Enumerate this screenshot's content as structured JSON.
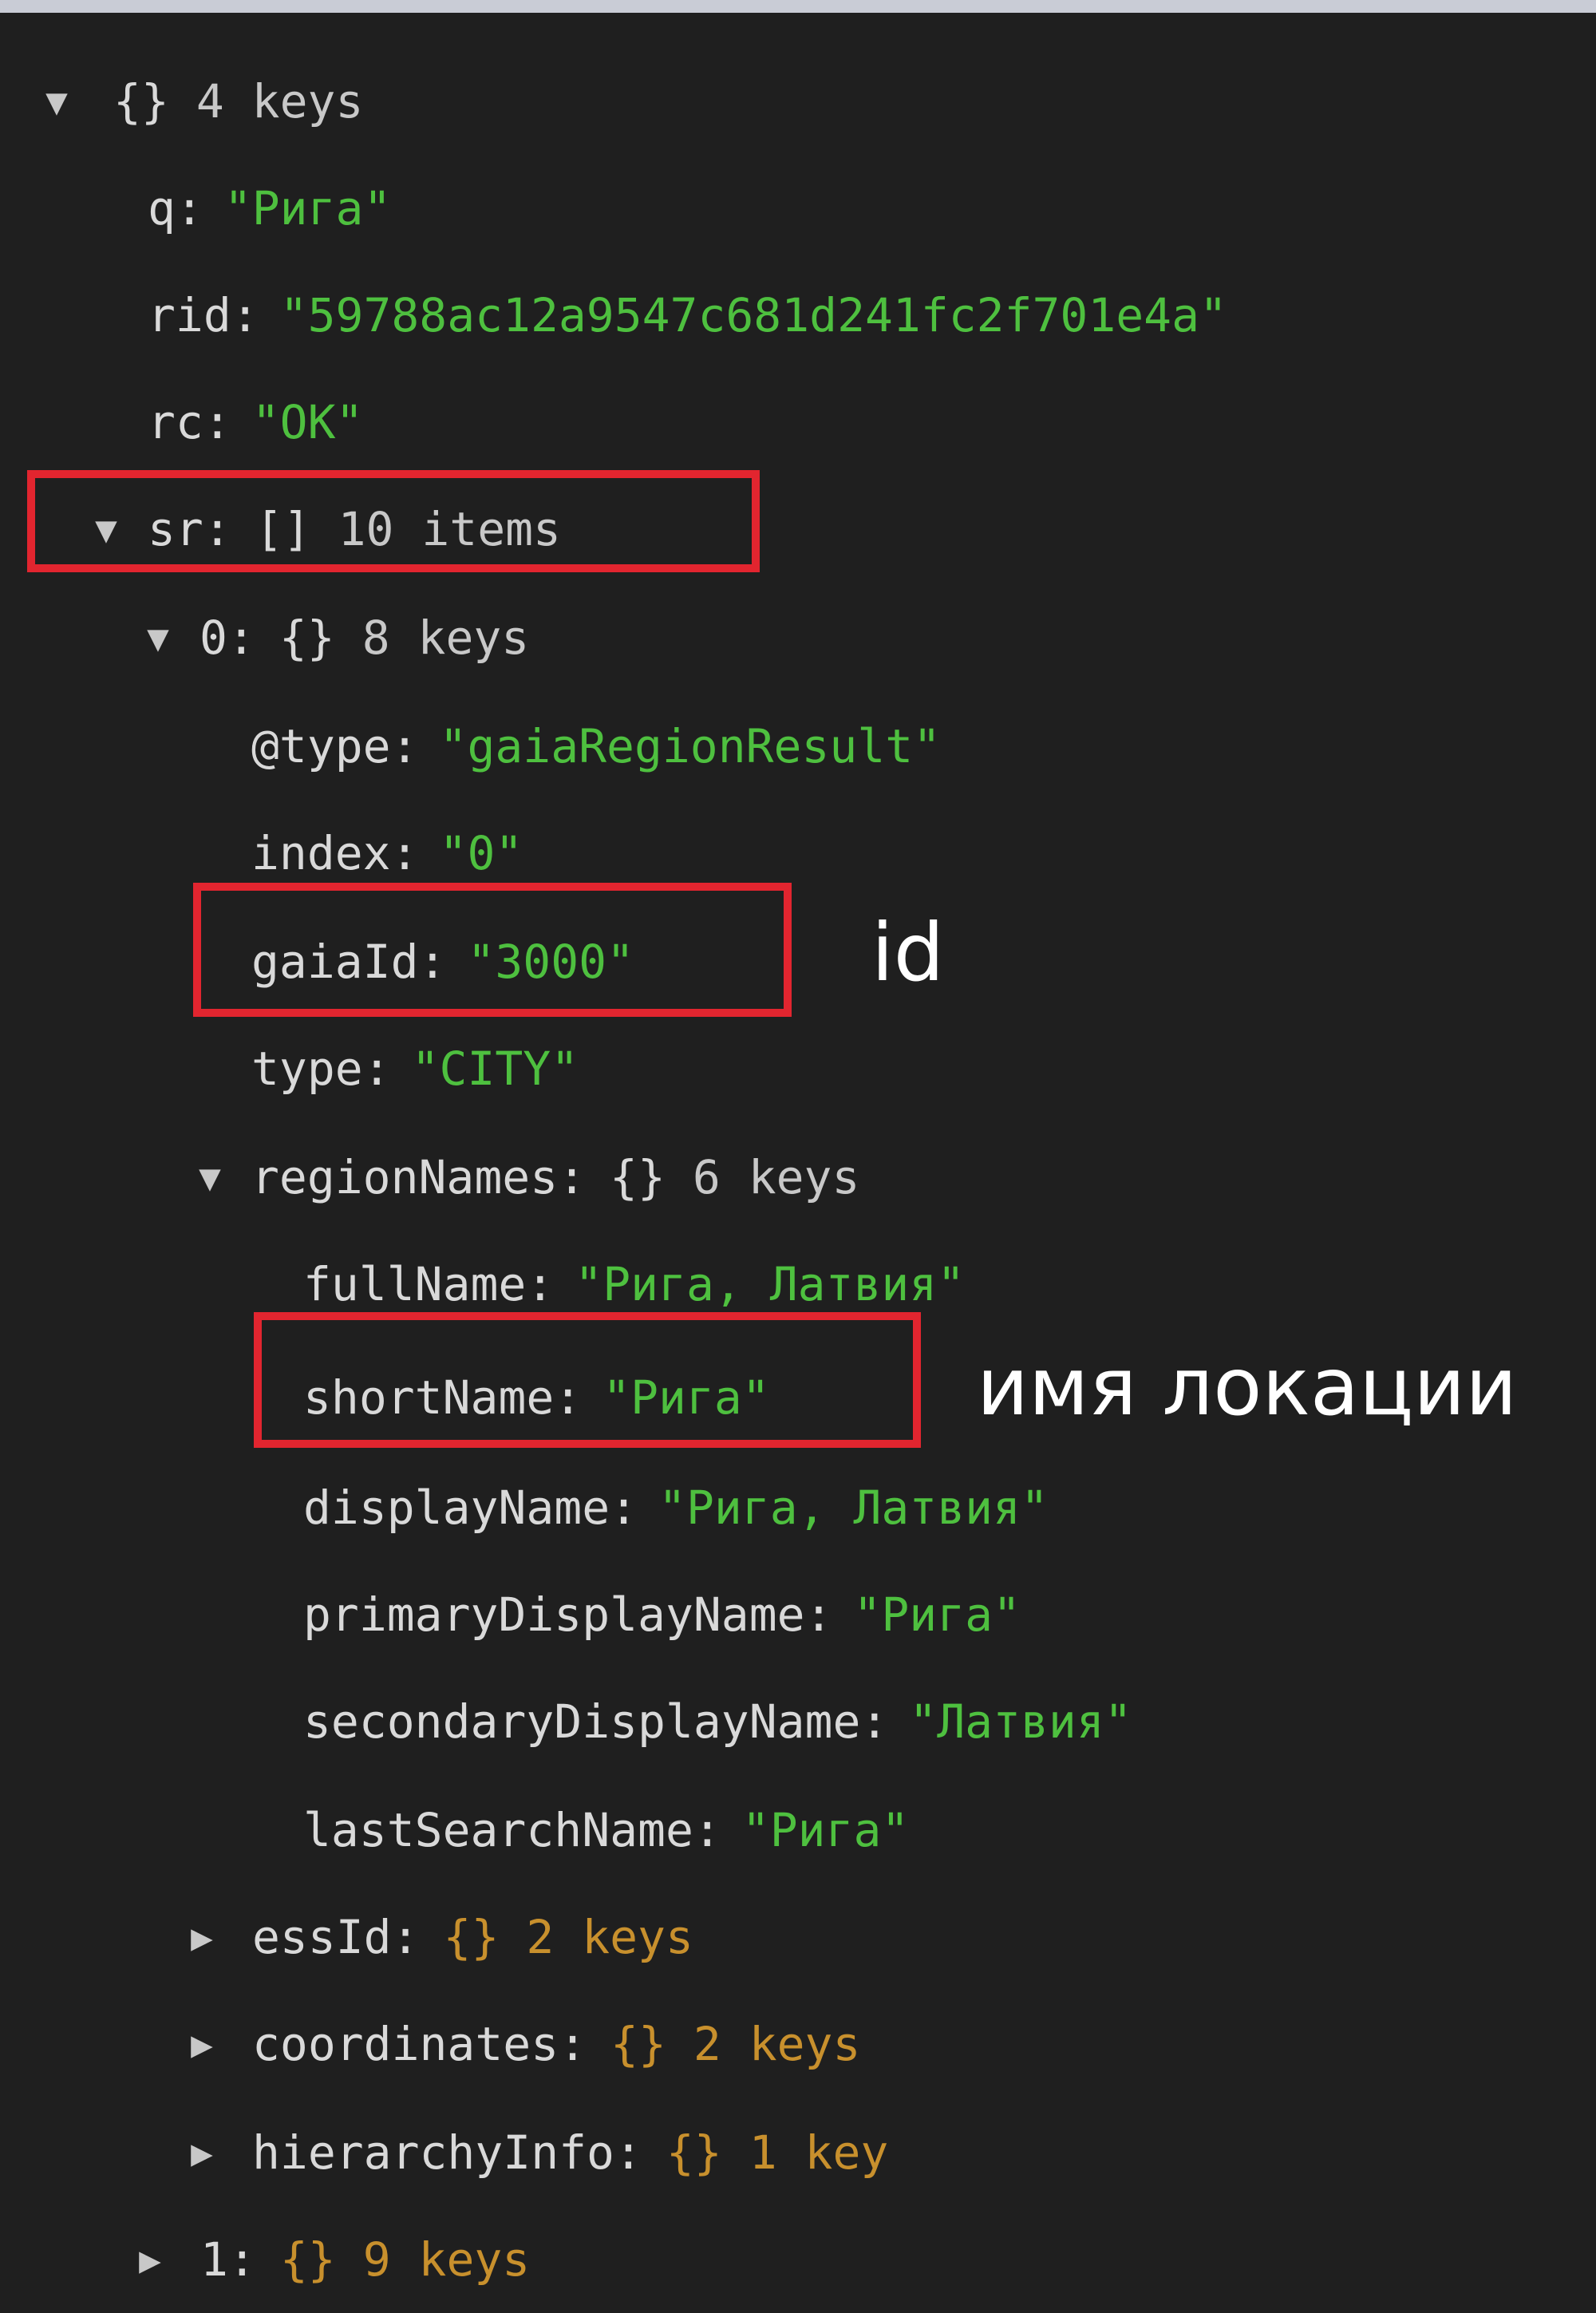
{
  "tree": {
    "root": {
      "open_brace": "{}",
      "summary": "4 keys"
    },
    "q": {
      "key": "q",
      "value": "\"Рига\""
    },
    "rid": {
      "key": "rid",
      "value": "\"59788ac12a9547c681d241fc2f701e4a\""
    },
    "rc": {
      "key": "rc",
      "value": "\"OK\""
    },
    "sr": {
      "key": "sr",
      "open_brace": "[]",
      "summary": "10 items"
    },
    "item0": {
      "key": "0",
      "open_brace": "{}",
      "summary": "8 keys"
    },
    "type_at": {
      "key": "@type",
      "value": "\"gaiaRegionResult\""
    },
    "index": {
      "key": "index",
      "value": "\"0\""
    },
    "gaiaId": {
      "key": "gaiaId",
      "value": "\"3000\""
    },
    "type": {
      "key": "type",
      "value": "\"CITY\""
    },
    "regionNames": {
      "key": "regionNames",
      "open_brace": "{}",
      "summary": "6 keys"
    },
    "fullName": {
      "key": "fullName",
      "value": "\"Рига, Латвия\""
    },
    "shortName": {
      "key": "shortName",
      "value": "\"Рига\""
    },
    "displayName": {
      "key": "displayName",
      "value": "\"Рига, Латвия\""
    },
    "primaryDisplayName": {
      "key": "primaryDisplayName",
      "value": "\"Рига\""
    },
    "secondaryDisplayName": {
      "key": "secondaryDisplayName",
      "value": "\"Латвия\""
    },
    "lastSearchName": {
      "key": "lastSearchName",
      "value": "\"Рига\""
    },
    "essId": {
      "key": "essId",
      "open_brace": "{}",
      "summary": "2 keys"
    },
    "coordinates": {
      "key": "coordinates",
      "open_brace": "{}",
      "summary": "2 keys"
    },
    "hierarchyInfo": {
      "key": "hierarchyInfo",
      "open_brace": "{}",
      "summary": "1 key"
    },
    "item1": {
      "key": "1",
      "open_brace": "{}",
      "summary": "9 keys"
    }
  },
  "annotations": {
    "id_label": "id",
    "location_label": "имя локации"
  },
  "colors": {
    "background": "#1f1f1f",
    "string": "#4ec03f",
    "collapsed_meta": "#c8902d",
    "highlight": "#e2252f"
  }
}
